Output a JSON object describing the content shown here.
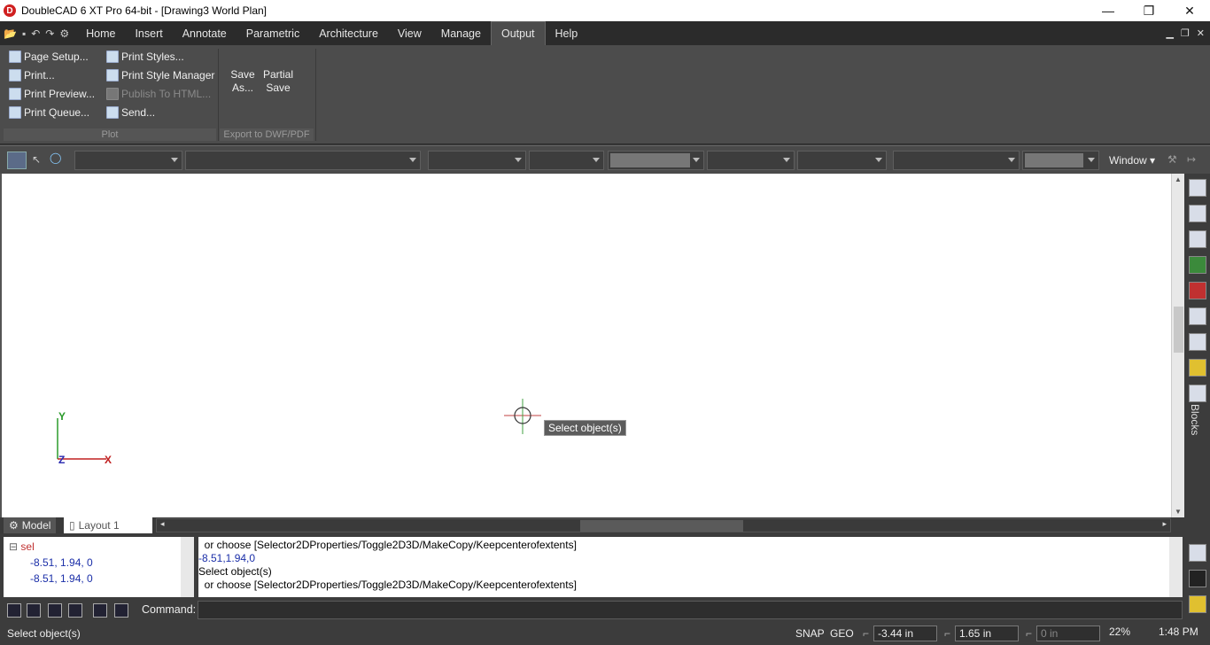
{
  "window": {
    "title": "DoubleCAD 6 XT Pro 64-bit - [Drawing3 World Plan]",
    "app_icon_letter": "D",
    "minimize": "—",
    "maximize": "❐",
    "close": "✕"
  },
  "menu": {
    "tabs": [
      "Home",
      "Insert",
      "Annotate",
      "Parametric",
      "Architecture",
      "View",
      "Manage",
      "Output",
      "Help"
    ],
    "active_tab": "Output"
  },
  "ribbon": {
    "plot": {
      "label": "Plot",
      "buttons": [
        "Page Setup...",
        "Print...",
        "Print Preview...",
        "Print Queue...",
        "Print Styles...",
        "Print Style Manager",
        "Publish To HTML...",
        "Send..."
      ]
    },
    "export": {
      "label": "Export to DWF/PDF",
      "save_as": [
        "Save",
        "As..."
      ],
      "partial_save": [
        "Partial",
        "Save"
      ]
    }
  },
  "propbar": {
    "window_label": "Window"
  },
  "canvas": {
    "axis_y": "Y",
    "axis_x": "X",
    "axis_z": "Z",
    "tooltip": "Select object(s)"
  },
  "right_panel": {
    "blocks_label": "Blocks"
  },
  "layout_tabs": [
    "Model",
    "Layout 1"
  ],
  "tree": {
    "root": "sel",
    "items": [
      "-8.51, 1.94, 0",
      "-8.51, 1.94, 0"
    ]
  },
  "command_history": [
    "  or choose [Selector2DProperties/Toggle2D3D/MakeCopy/Keepcenterofextents]",
    "-8.51,1.94,0",
    "Select object(s)",
    "  or choose [Selector2DProperties/Toggle2D3D/MakeCopy/Keepcenterofextents]"
  ],
  "command": {
    "label": "Command:"
  },
  "status": {
    "message": "Select object(s)",
    "snap": "SNAP",
    "geo": "GEO",
    "x": "-3.44 in",
    "y": "1.65 in",
    "z": "0 in",
    "zoom": "22%",
    "time": "1:48 PM"
  }
}
